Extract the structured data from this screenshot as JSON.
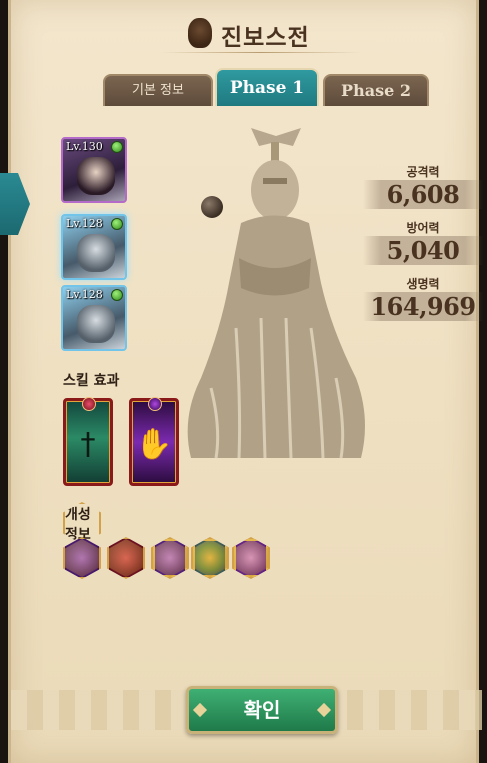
{
  "header": {
    "title": "진보스전",
    "icon": "shield-knight-icon"
  },
  "tabs": [
    {
      "label": "기본 정보",
      "active": false
    },
    {
      "label": "Phase 1",
      "active": true
    },
    {
      "label": "Phase 2",
      "active": false
    }
  ],
  "heroes": [
    {
      "level": "Lv.130",
      "icon": "hero-portrait-icon"
    },
    {
      "level": "Lv.128",
      "icon": "armor-knight-icon"
    },
    {
      "level": "Lv.128",
      "icon": "armor-knight-icon"
    }
  ],
  "stats": {
    "attack_label": "공격력",
    "attack_value": "6,608",
    "defense_label": "방어력",
    "defense_value": "5,040",
    "hp_label": "생명력",
    "hp_value": "164,969"
  },
  "sections": {
    "skill_title": "스킬 효과",
    "trait_title": "개성 정보"
  },
  "skills": [
    {
      "icon": "sword-skill-icon"
    },
    {
      "icon": "dark-hand-skill-icon"
    }
  ],
  "traits": [
    {
      "icon": "claw-trait-icon"
    },
    {
      "icon": "gear-trait-icon"
    },
    {
      "icon": "purple-sigil-trait-icon"
    },
    {
      "icon": "elements-trait-icon"
    },
    {
      "icon": "purple-gear-trait-icon"
    }
  ],
  "footer": {
    "confirm_label": "확인"
  },
  "colors": {
    "accent_teal": "#1f7a80",
    "confirm_green": "#2f9a5e",
    "panel_bg": "#f3e6cc",
    "text_brown": "#4a3220"
  }
}
